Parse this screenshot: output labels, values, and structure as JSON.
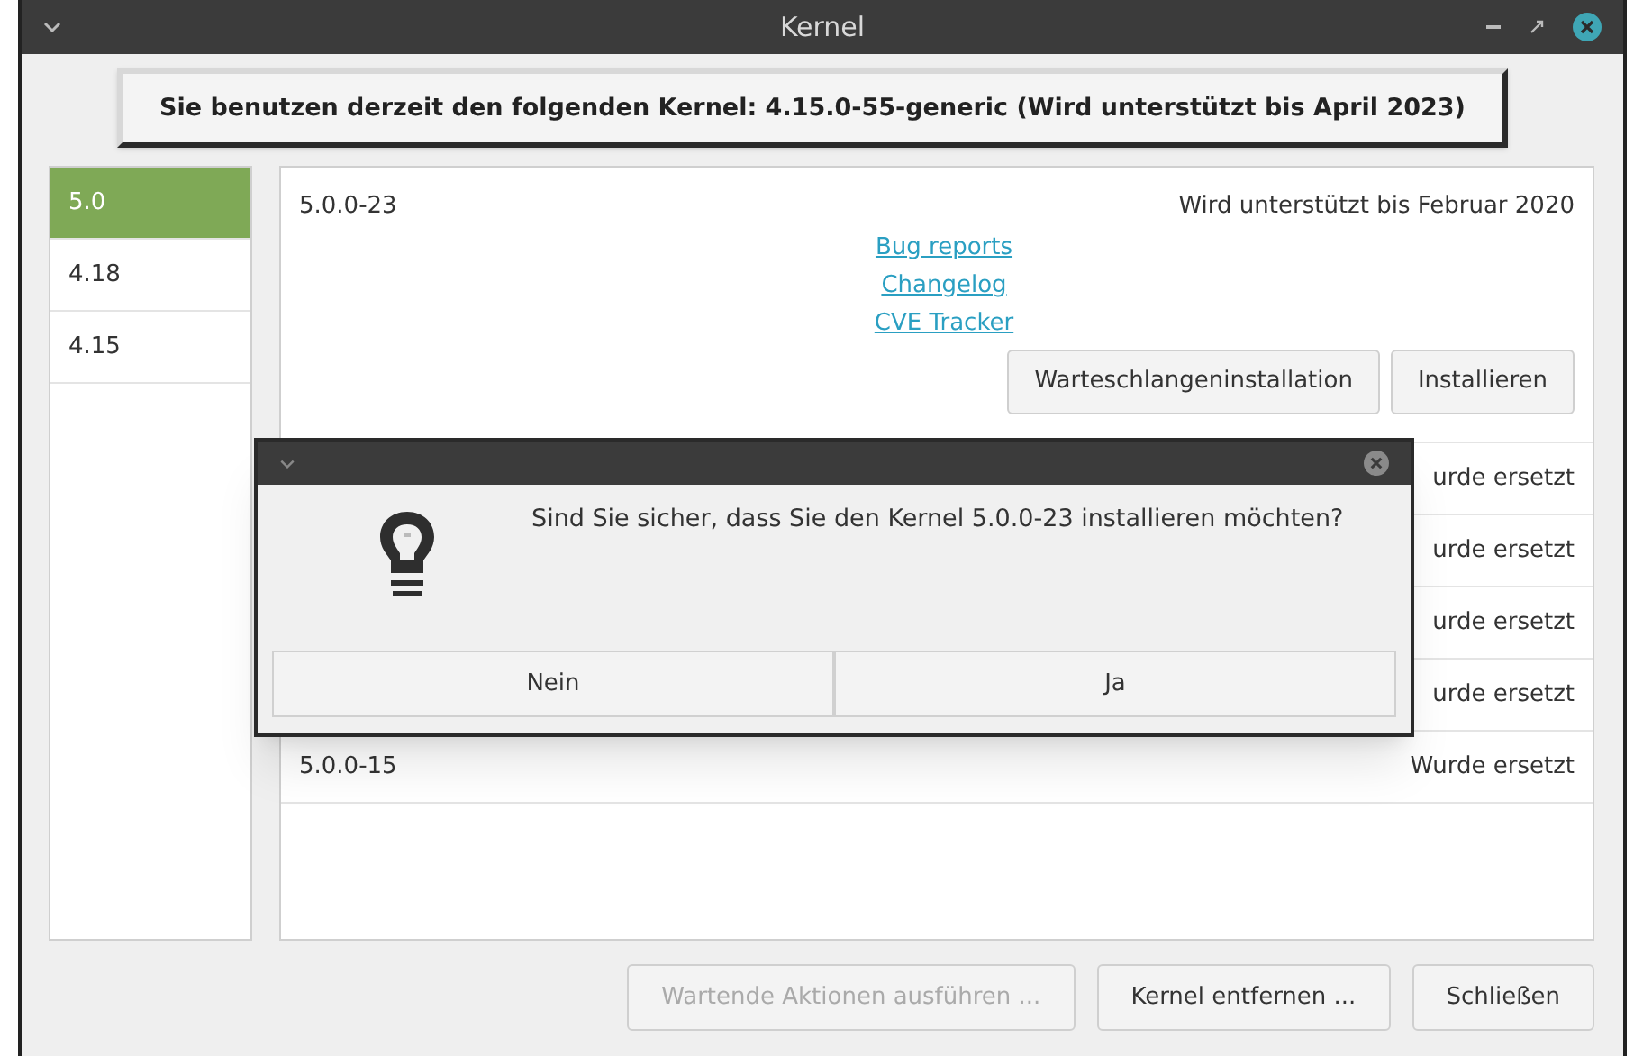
{
  "window": {
    "title": "Kernel"
  },
  "current_kernel": "Sie benutzen derzeit den folgenden Kernel: 4.15.0-55-generic (Wird unterstützt bis April 2023)",
  "sidebar": {
    "items": [
      {
        "label": "5.0",
        "selected": true
      },
      {
        "label": "4.18",
        "selected": false
      },
      {
        "label": "4.15",
        "selected": false
      }
    ]
  },
  "kernels": [
    {
      "version": "5.0.0-23",
      "status": "Wird unterstützt bis Februar 2020",
      "expanded": true,
      "links": [
        "Bug reports",
        "Changelog",
        "CVE Tracker"
      ],
      "buttons": [
        "Warteschlangeninstallation",
        "Installieren"
      ]
    },
    {
      "status": "urde ersetzt",
      "expanded": false
    },
    {
      "status": "urde ersetzt",
      "expanded": false
    },
    {
      "status": "urde ersetzt",
      "expanded": false
    },
    {
      "status": "urde ersetzt",
      "expanded": false
    },
    {
      "version": "5.0.0-15",
      "status": "Wurde ersetzt",
      "expanded": false
    }
  ],
  "footer_buttons": [
    {
      "label": "Wartende Aktionen ausführen ...",
      "disabled": true
    },
    {
      "label": "Kernel entfernen ...",
      "disabled": false
    },
    {
      "label": "Schließen",
      "disabled": false
    }
  ],
  "dialog": {
    "message": "Sind Sie sicher, dass Sie den Kernel 5.0.0-23 installieren möchten?",
    "buttons": [
      "Nein",
      "Ja"
    ]
  }
}
